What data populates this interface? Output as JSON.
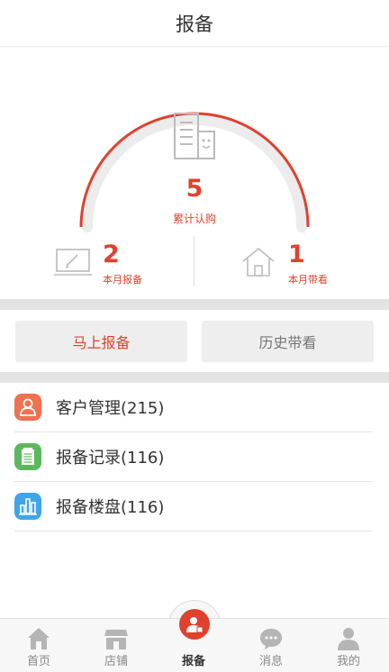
{
  "header": {
    "title": "报备"
  },
  "summary": {
    "total_value": "5",
    "total_label": "累计认购"
  },
  "stats": {
    "monthly_reports": {
      "value": "2",
      "label": "本月报备"
    },
    "monthly_visits": {
      "value": "1",
      "label": "本月带看"
    }
  },
  "actions": {
    "report_now": "马上报备",
    "visit_history": "历史带看"
  },
  "menu": [
    {
      "label": "客户管理(215)",
      "icon": "user-icon",
      "color": "#f0714f"
    },
    {
      "label": "报备记录(116)",
      "icon": "notepad-icon",
      "color": "#5cb85c"
    },
    {
      "label": "报备楼盘(116)",
      "icon": "building-chart-icon",
      "color": "#3fa5e8"
    }
  ],
  "tabs": [
    {
      "label": "首页",
      "icon": "home-icon"
    },
    {
      "label": "店铺",
      "icon": "store-icon"
    },
    {
      "label": "报备",
      "icon": "report-user-icon"
    },
    {
      "label": "消息",
      "icon": "chat-icon"
    },
    {
      "label": "我的",
      "icon": "profile-icon"
    }
  ],
  "colors": {
    "accent": "#e0412d",
    "band": "#e3e3e3",
    "button_bg": "#eeeeee"
  }
}
